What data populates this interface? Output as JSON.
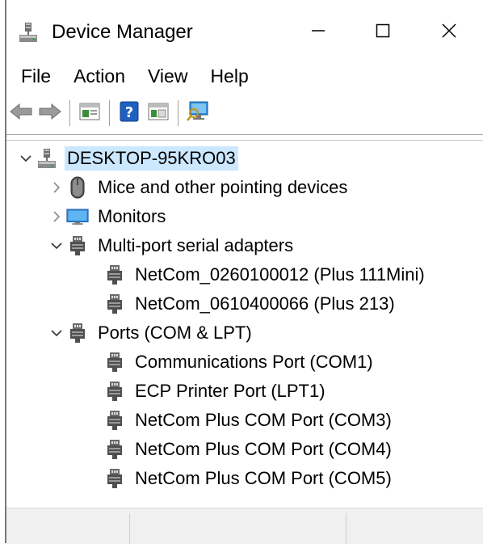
{
  "window": {
    "title": "Device Manager",
    "icon": "device-manager-icon",
    "controls": {
      "minimize": "minimize-icon",
      "maximize": "maximize-icon",
      "close": "close-icon"
    }
  },
  "menu": [
    "File",
    "Action",
    "View",
    "Help"
  ],
  "toolbar": [
    "back-arrow-icon",
    "forward-arrow-icon",
    "properties-icon",
    "help-icon",
    "update-driver-icon",
    "scan-hardware-icon"
  ],
  "tree": {
    "root": "DESKTOP-95KRO03",
    "categories": [
      {
        "label": "Mice and other pointing devices",
        "icon": "mouse-icon",
        "expanded": false,
        "children": []
      },
      {
        "label": "Monitors",
        "icon": "monitor-icon",
        "expanded": false,
        "children": []
      },
      {
        "label": "Multi-port serial adapters",
        "icon": "port-icon",
        "expanded": true,
        "children": [
          "NetCom_0260100012 (Plus 111Mini)",
          "NetCom_0610400066 (Plus 213)"
        ]
      },
      {
        "label": "Ports (COM & LPT)",
        "icon": "port-icon",
        "expanded": true,
        "children": [
          "Communications Port (COM1)",
          "ECP Printer Port (LPT1)",
          "NetCom Plus COM Port (COM3)",
          "NetCom Plus COM Port (COM4)",
          "NetCom Plus COM Port (COM5)"
        ]
      }
    ]
  },
  "colors": {
    "selection": "#cce8ff",
    "accent": "#1e73d2"
  }
}
